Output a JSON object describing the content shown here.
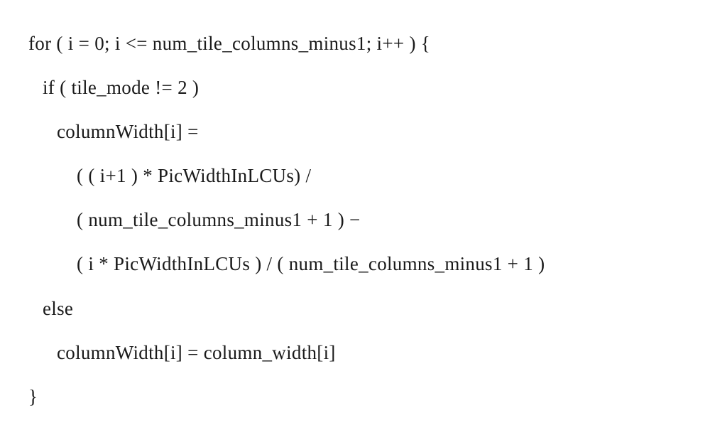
{
  "code": {
    "l1": "for ( i = 0; i <= num_tile_columns_minus1; i++ ) {",
    "l2": "if ( tile_mode != 2 )",
    "l3": "columnWidth[i] =",
    "l4": "( ( i+1 ) * PicWidthInLCUs) /",
    "l5": "( num_tile_columns_minus1 + 1 ) −",
    "l6": "( i * PicWidthInLCUs ) / ( num_tile_columns_minus1 + 1 )",
    "l7": "else",
    "l8": "columnWidth[i] = column_width[i]",
    "l9": "}"
  }
}
